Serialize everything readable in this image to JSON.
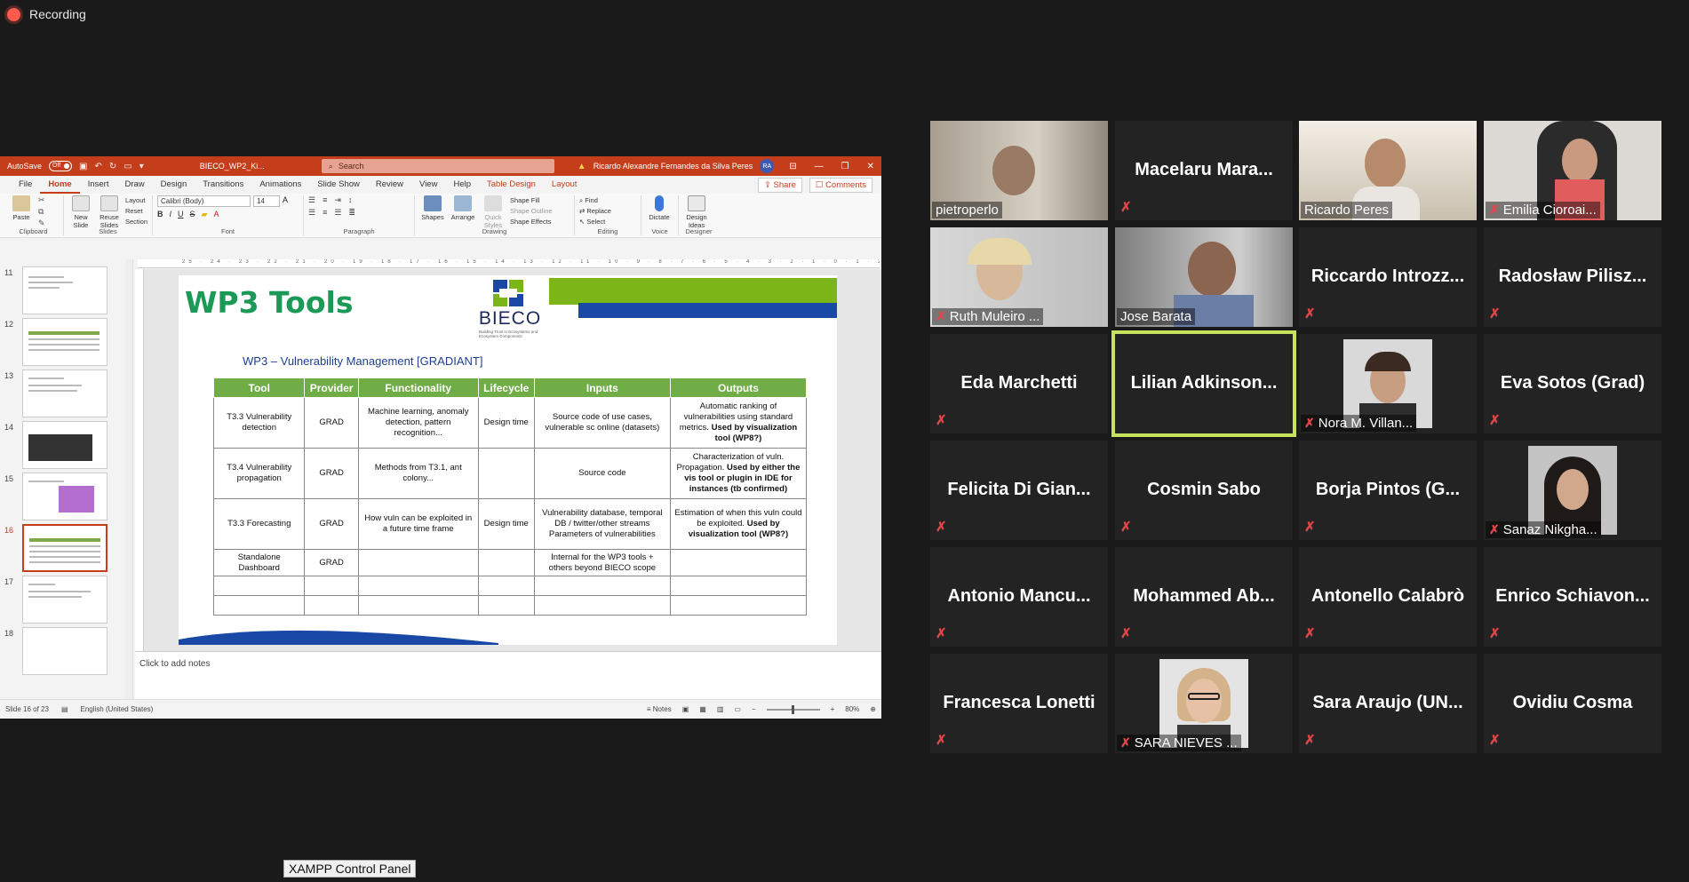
{
  "recording": {
    "label": "Recording"
  },
  "ppt": {
    "titlebar": {
      "autosave": "AutoSave",
      "toggle": "Off",
      "doc_name": "BIECO_WP2_Ki...",
      "search_placeholder": "Search",
      "user": "Ricardo Alexandre Fernandes da Silva Peres",
      "user_initials": "RA"
    },
    "menu": [
      "File",
      "Home",
      "Insert",
      "Draw",
      "Design",
      "Transitions",
      "Animations",
      "Slide Show",
      "Review",
      "View",
      "Help",
      "Table Design",
      "Layout"
    ],
    "active_menu": "Home",
    "share": "Share",
    "comments": "Comments",
    "ribbon": {
      "clipboard": {
        "paste": "Paste",
        "label": "Clipboard"
      },
      "slides": {
        "new_slide": "New Slide",
        "reuse": "Reuse Slides",
        "layout": "Layout",
        "reset": "Reset",
        "section": "Section",
        "label": "Slides"
      },
      "font": {
        "name": "Calibri (Body)",
        "size": "14",
        "label": "Font"
      },
      "paragraph": {
        "label": "Paragraph"
      },
      "drawing": {
        "shapes": "Shapes",
        "arrange": "Arrange",
        "quick_styles": "Quick Styles",
        "fill": "Shape Fill",
        "outline": "Shape Outline",
        "effects": "Shape Effects",
        "label": "Drawing"
      },
      "editing": {
        "find": "Find",
        "replace": "Replace",
        "select": "Select",
        "label": "Editing"
      },
      "voice": {
        "dictate": "Dictate",
        "label": "Voice"
      },
      "designer": {
        "ideas": "Design Ideas",
        "label": "Designer"
      }
    },
    "ruler_text": "25 · 24 · 23 · 22 · 21 · 20 · 19 · 18 · 17 · 16 · 15 · 14 · 13 · 12 · 11 · 10 · 9 · 8 · 7 · 6 · 5 · 4 · 3 · 2 · 1 · 0 · 1 · 2 · 3 · 4 · 5 · 6 · 7 · 8",
    "thumbnails": [
      "11",
      "12",
      "13",
      "14",
      "15",
      "16",
      "17",
      "18"
    ],
    "selected_thumb": "16",
    "slide": {
      "title": "WP3 Tools",
      "logo_text": "BIECO",
      "logo_sub": "Building Trust in Ecosystems and Ecosystem Components",
      "subtitle": "WP3 – Vulnerability Management [GRADIANT]",
      "table": {
        "headers": [
          "Tool",
          "Provider",
          "Functionality",
          "Lifecycle",
          "Inputs",
          "Outputs"
        ],
        "rows": [
          {
            "tool": "T3.3 Vulnerability detection",
            "provider": "GRAD",
            "functionality": "Machine learning, anomaly detection, pattern recognition...",
            "lifecycle": "Design time",
            "inputs": "Source code of use cases, vulnerable sc online (datasets)",
            "outputs_a": "Automatic ranking of vulnerabilities using standard metrics.",
            "outputs_b": "Used by visualization tool (WP8?)"
          },
          {
            "tool": "T3.4 Vulnerability propagation",
            "provider": "GRAD",
            "functionality": "Methods from T3.1, ant colony...",
            "lifecycle": "",
            "inputs": "Source code",
            "outputs_a": "Characterization of vuln. Propagation.",
            "outputs_b": "Used by either the vis tool or plugin in IDE for instances (tb confirmed)"
          },
          {
            "tool": "T3.3 Forecasting",
            "provider": "GRAD",
            "functionality": "How vuln can be exploited in a future time frame",
            "lifecycle": "Design time",
            "inputs": "Vulnerability database, temporal DB / twitter/other streams Parameters of vulnerabilities",
            "outputs_a": "Estimation of when this vuln could be exploited.",
            "outputs_b": "Used by visualization tool (WP8?)"
          },
          {
            "tool": "Standalone Dashboard",
            "provider": "GRAD",
            "functionality": "",
            "lifecycle": "",
            "inputs": "Internal for the WP3 tools + others beyond BIECO scope",
            "outputs_a": "",
            "outputs_b": ""
          }
        ]
      }
    },
    "notes": "Click to add notes",
    "status": {
      "slide": "Slide 16 of 23",
      "language": "English (United States)",
      "notes": "Notes",
      "zoom": "80%"
    }
  },
  "participants": [
    {
      "name": "pietroperlo",
      "video": true,
      "muted": false
    },
    {
      "name": "Macelaru Mara...",
      "video": false,
      "muted": true
    },
    {
      "name": "Ricardo Peres",
      "video": true,
      "muted": false
    },
    {
      "name": "Emilia Cioroai...",
      "video": true,
      "muted": true
    },
    {
      "name": "Ruth Muleiro ...",
      "video": true,
      "muted": true
    },
    {
      "name": "Jose Barata",
      "video": true,
      "muted": false
    },
    {
      "name": "Riccardo Introzz...",
      "video": false,
      "muted": true
    },
    {
      "name": "Radosław Pilisz...",
      "video": false,
      "muted": true
    },
    {
      "name": "Eda Marchetti",
      "video": false,
      "muted": true
    },
    {
      "name": "Lilian Adkinson...",
      "video": false,
      "muted": false,
      "active": true
    },
    {
      "name": "Nora M. Villan...",
      "video": "photo",
      "muted": true
    },
    {
      "name": "Eva Sotos (Grad)",
      "video": false,
      "muted": true
    },
    {
      "name": "Felicita Di Gian...",
      "video": false,
      "muted": true
    },
    {
      "name": "Cosmin Sabo",
      "video": false,
      "muted": true
    },
    {
      "name": "Borja Pintos (G...",
      "video": false,
      "muted": true
    },
    {
      "name": "Sanaz Nikgha...",
      "video": "photo",
      "muted": true
    },
    {
      "name": "Antonio Mancu...",
      "video": false,
      "muted": true
    },
    {
      "name": "Mohammed Ab...",
      "video": false,
      "muted": true
    },
    {
      "name": "Antonello Calabrò",
      "video": false,
      "muted": true
    },
    {
      "name": "Enrico Schiavon...",
      "video": false,
      "muted": true
    },
    {
      "name": "Francesca Lonetti",
      "video": false,
      "muted": true
    },
    {
      "name": "SARA NIEVES ...",
      "video": "photo",
      "muted": true
    },
    {
      "name": "Sara Araujo (UN...",
      "video": false,
      "muted": true
    },
    {
      "name": "Ovidiu Cosma",
      "video": false,
      "muted": true
    }
  ],
  "taskbar_tooltip": "XAMPP Control Panel"
}
